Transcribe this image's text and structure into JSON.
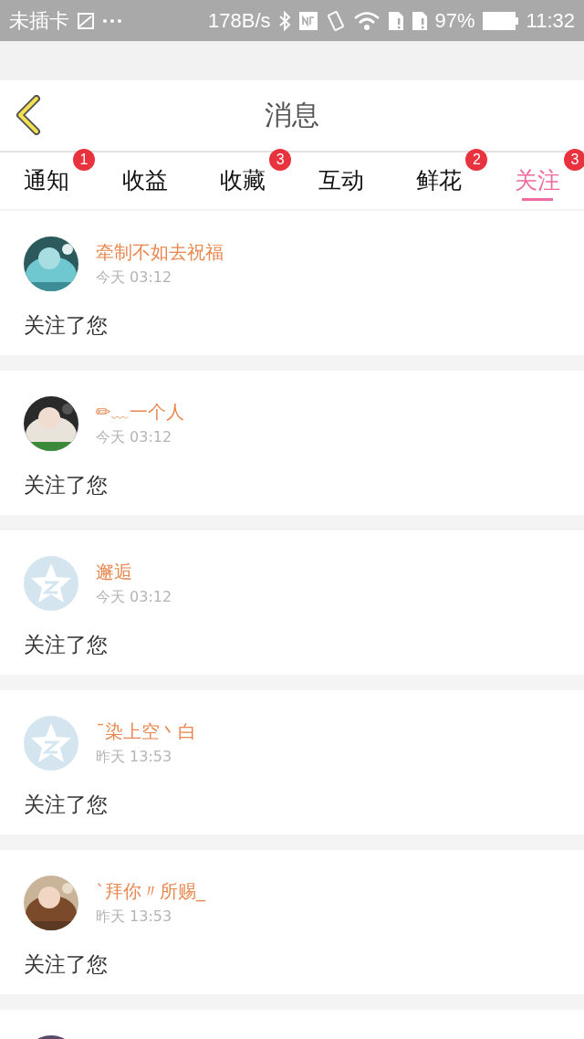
{
  "status_bar": {
    "carrier": "未插卡",
    "speed": "178B/s",
    "battery": "97%",
    "time": "11:32"
  },
  "header": {
    "title": "消息"
  },
  "tabs": [
    {
      "label": "通知",
      "badge": "1",
      "selected": false
    },
    {
      "label": "收益",
      "selected": false
    },
    {
      "label": "收藏",
      "badge": "3",
      "selected": false
    },
    {
      "label": "互动",
      "selected": false
    },
    {
      "label": "鲜花",
      "badge": "2",
      "selected": false
    },
    {
      "label": "关注",
      "badge": "3",
      "selected": true
    }
  ],
  "messages": [
    {
      "kind": "picture",
      "name": "牵制不如去祝福",
      "time": "今天 03:12",
      "text": "关注了您"
    },
    {
      "kind": "picture",
      "name": "✏﹏一个人",
      "time": "今天 03:12",
      "text": "关注了您"
    },
    {
      "kind": "default",
      "name": "邂逅",
      "time": "今天 03:12",
      "text": "关注了您"
    },
    {
      "kind": "default",
      "name": "ˉ染上空丶白",
      "time": "昨天 13:53",
      "text": "关注了您"
    },
    {
      "kind": "picture",
      "name": "ˋ拜你〃所赐_",
      "time": "昨天 13:53",
      "text": "关注了您"
    },
    {
      "kind": "picture"
    }
  ]
}
